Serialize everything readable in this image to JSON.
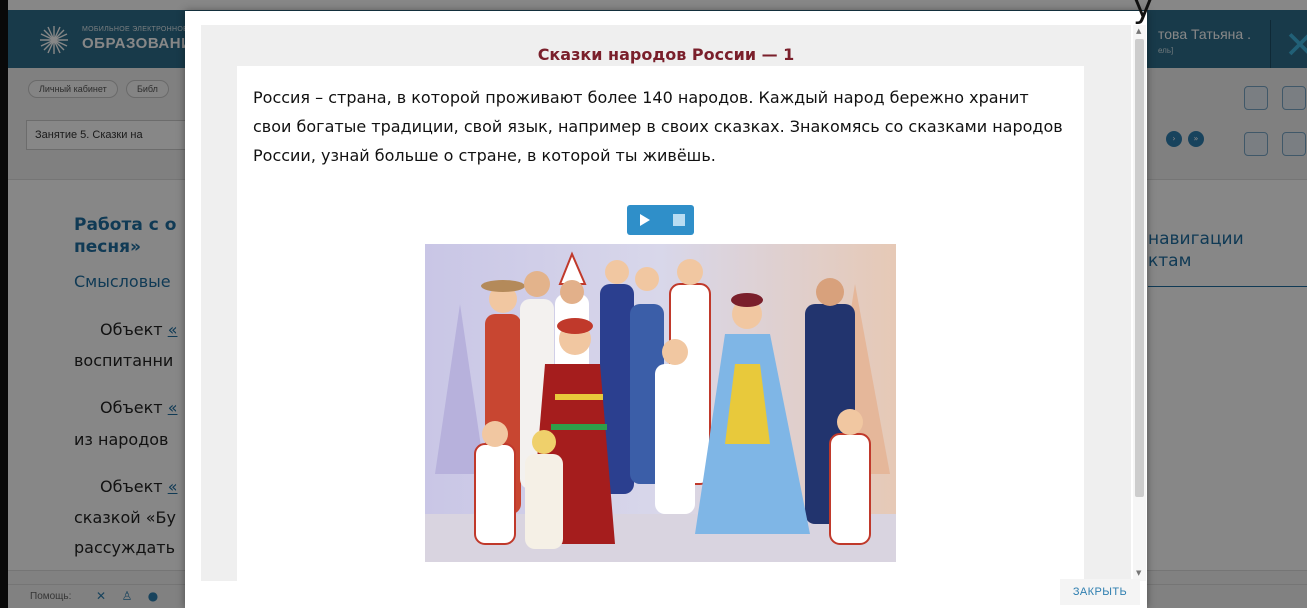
{
  "header": {
    "logo_small": "МОБИЛЬНОЕ ЭЛЕКТРОННОЕ",
    "logo_big": "ОБРАЗОВАНИЕ",
    "user_name": "това Татьяна .",
    "user_role": "ель]"
  },
  "breadcrumbs": [
    {
      "label": "Личный кабинет"
    },
    {
      "label": "Библ"
    }
  ],
  "lesson_selector": {
    "value": "Занятие 5. Сказки на"
  },
  "content": {
    "title_line1": "Работа с о",
    "title_line2": "песня»",
    "subtitle": "Смысловые",
    "lines": [
      {
        "prefix": "Объект ",
        "link": "«"
      },
      {
        "text": "воспитанни"
      },
      {
        "prefix": "Объект ",
        "link": "«"
      },
      {
        "text": "из народов"
      },
      {
        "prefix": "Объект ",
        "link": "«"
      },
      {
        "text": "сказкой «Бу"
      },
      {
        "text": "рассуждать"
      }
    ],
    "right_nav_line1": "навигации",
    "right_nav_line2": "ктам"
  },
  "footer": {
    "help_label": "Помощь:"
  },
  "modal": {
    "title": "Сказки народов России — 1",
    "text": "Россия – страна, в которой проживают более 140 народов. Каждый народ бережно хранит свои богатые традиции, свой язык, например в своих сказках. Знакомясь со сказками народов России, узнай больше о стране, в которой ты живёшь.",
    "close_label": "ЗАКРЫТЬ"
  },
  "icons": {
    "play": "play-icon",
    "stop": "stop-icon",
    "close": "close-icon"
  },
  "colors": {
    "header_bg": "#2f6f8c",
    "modal_title": "#7a1f2b",
    "accent": "#2f8fc9",
    "link": "#1f6ea0"
  },
  "top_glyph": "у"
}
